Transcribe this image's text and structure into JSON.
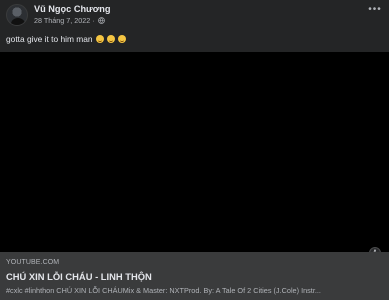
{
  "post": {
    "author": "Vũ Ngọc Chương",
    "date": "28 Tháng 7, 2022 ·",
    "privacy_icon": "globe-icon",
    "more_icon": "more-icon",
    "text": "gotta give it to him man",
    "emojis": [
      "rolling-on-floor-laughing",
      "rolling-on-floor-laughing",
      "rolling-on-floor-laughing"
    ]
  },
  "link_preview": {
    "domain": "YOUTUBE.COM",
    "title": "CHÚ XIN LỖI CHÁU - LINH THỘN",
    "description": "#cxlc #linhthon CHÚ XIN LỖI CHÁUMix & Master: NXTProd. By: A Tale Of 2 Cities (J.Cole) Instr...",
    "info_icon": "i"
  },
  "colors": {
    "background": "#242526",
    "preview_background": "#3a3b3c",
    "media_background": "#000000",
    "primary_text": "#e4e6eb",
    "secondary_text": "#b0b3b8"
  }
}
